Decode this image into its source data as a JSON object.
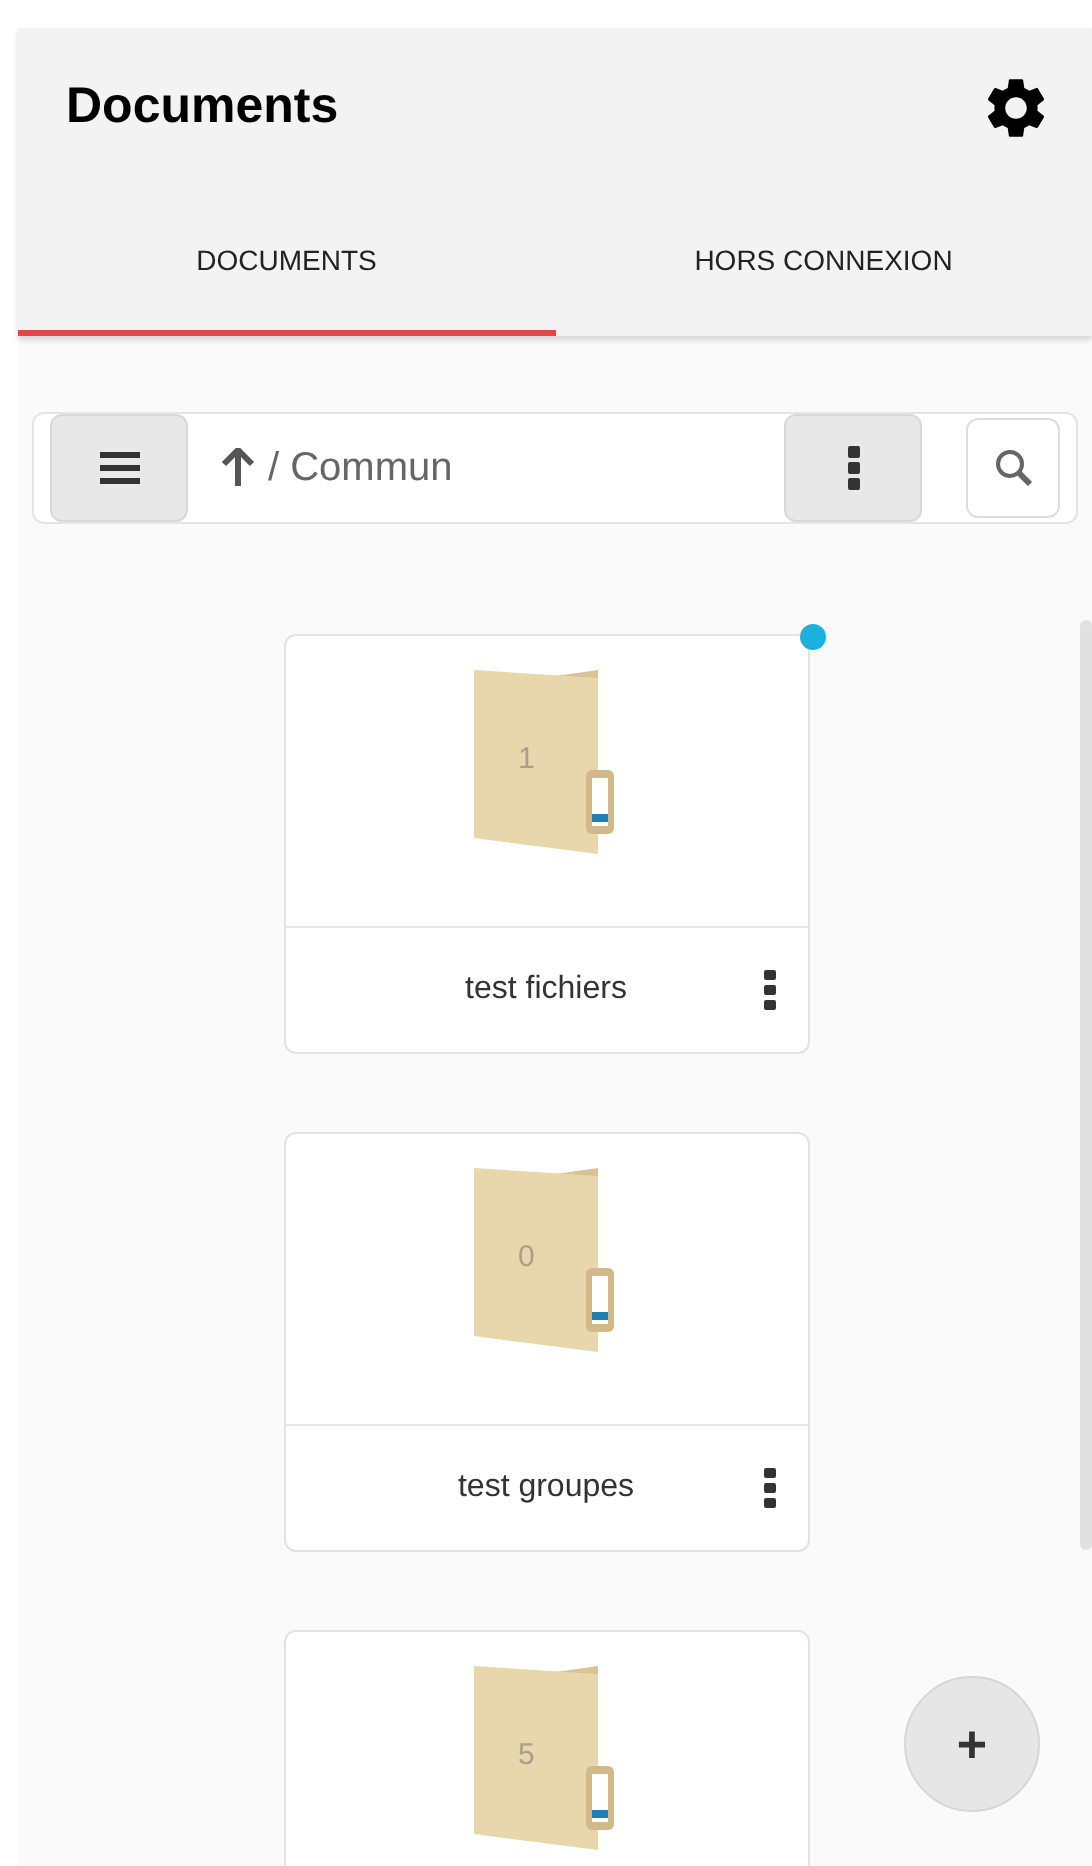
{
  "header": {
    "title": "Documents"
  },
  "tabs": [
    {
      "label": "DOCUMENTS",
      "selected": true
    },
    {
      "label": "HORS CONNEXION",
      "selected": false
    }
  ],
  "toolbar": {
    "path": "/ Commun"
  },
  "folders": [
    {
      "count": "1",
      "name": "test fichiers",
      "unread": true
    },
    {
      "count": "0",
      "name": "test groupes",
      "unread": false
    },
    {
      "count": "5",
      "unread": false
    }
  ],
  "fab": {
    "label": "+"
  }
}
